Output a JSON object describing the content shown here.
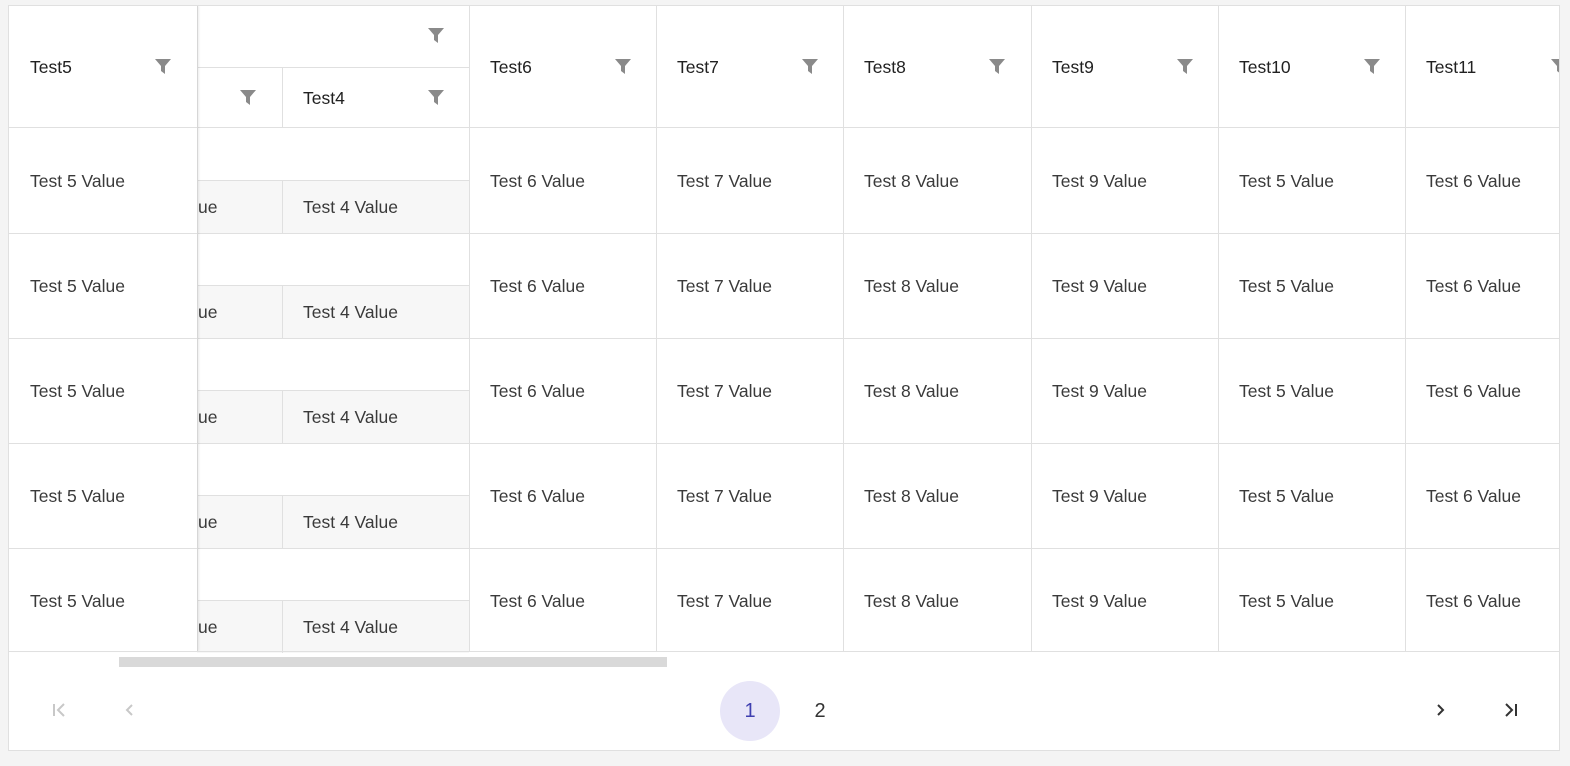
{
  "grid": {
    "header_group_top": "",
    "columns_scroll": [
      {
        "label": "Test6",
        "col": 0
      },
      {
        "label": "Test7",
        "col": 1
      },
      {
        "label": "Test8",
        "col": 2
      },
      {
        "label": "Test9",
        "col": 3
      },
      {
        "label": "Test10",
        "col": 4
      },
      {
        "label": "Test11",
        "col": 5
      }
    ],
    "sub_column_label": "Test4",
    "frozen_column_label": "Test5",
    "rows": [
      {
        "test5": "Test 5 Value",
        "test3": "ue",
        "test4": "Test 4 Value",
        "test6": "Test 6 Value",
        "test7": "Test 7 Value",
        "test8": "Test 8 Value",
        "test9": "Test 9 Value",
        "test10": "Test 5 Value",
        "test11": "Test 6 Value"
      },
      {
        "test5": "Test 5 Value",
        "test3": "ue",
        "test4": "Test 4 Value",
        "test6": "Test 6 Value",
        "test7": "Test 7 Value",
        "test8": "Test 8 Value",
        "test9": "Test 9 Value",
        "test10": "Test 5 Value",
        "test11": "Test 6 Value"
      },
      {
        "test5": "Test 5 Value",
        "test3": "ue",
        "test4": "Test 4 Value",
        "test6": "Test 6 Value",
        "test7": "Test 7 Value",
        "test8": "Test 8 Value",
        "test9": "Test 9 Value",
        "test10": "Test 5 Value",
        "test11": "Test 6 Value"
      },
      {
        "test5": "Test 5 Value",
        "test3": "ue",
        "test4": "Test 4 Value",
        "test6": "Test 6 Value",
        "test7": "Test 7 Value",
        "test8": "Test 8 Value",
        "test9": "Test 9 Value",
        "test10": "Test 5 Value",
        "test11": "Test 6 Value"
      },
      {
        "test5": "Test 5 Value",
        "test3": "ue",
        "test4": "Test 4 Value",
        "test6": "Test 6 Value",
        "test7": "Test 7 Value",
        "test8": "Test 8 Value",
        "test9": "Test 9 Value",
        "test10": "Test 5 Value",
        "test11": "Test 6 Value"
      }
    ],
    "filter_icon": "filter-icon",
    "filter_color": "#8a8a8a"
  },
  "pager": {
    "first_icon": "first-page-icon",
    "prev_icon": "previous-page-icon",
    "pages": [
      "1",
      "2"
    ],
    "current_page": "1",
    "next_icon": "next-page-icon",
    "last_icon": "last-page-icon",
    "active_bg": "#e8e6f8",
    "active_color": "#3f3fb0"
  }
}
